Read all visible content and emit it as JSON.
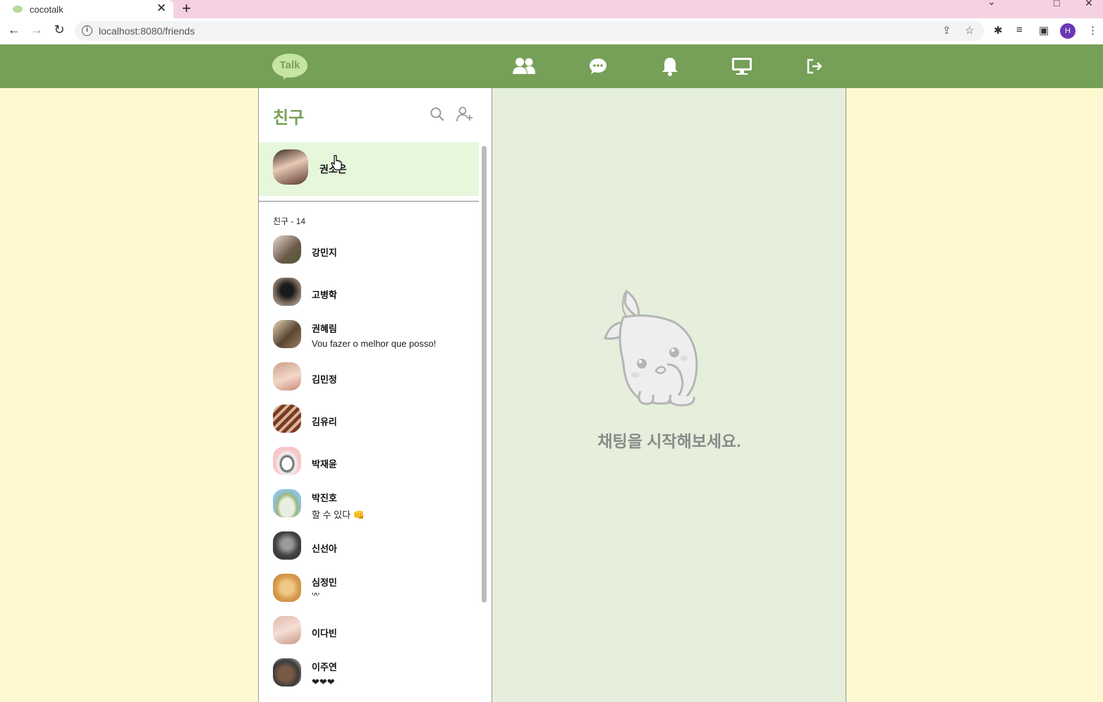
{
  "browser": {
    "tab_title": "cocotalk",
    "tab_close": "✕",
    "new_tab": "+",
    "url": "localhost:8080/friends",
    "profile_initial": "H"
  },
  "app": {
    "logo_text": "Talk",
    "colors": {
      "header": "#76a057",
      "page_bg": "#fef9d0",
      "chat_bg": "#e5efdc",
      "selected_bg": "#e6f7db"
    },
    "nav": [
      "friends-icon",
      "chat-icon",
      "bell-icon",
      "monitor-icon",
      "logout-icon"
    ]
  },
  "friends_panel": {
    "title": "친구",
    "my_profile": {
      "name": "권소은"
    },
    "section_label": "친구 - 14",
    "friends": [
      {
        "name": "강민지",
        "status": ""
      },
      {
        "name": "고병학",
        "status": ""
      },
      {
        "name": "권혜림",
        "status": "Vou fazer o melhor que posso!"
      },
      {
        "name": "김민정",
        "status": ""
      },
      {
        "name": "김유리",
        "status": ""
      },
      {
        "name": "박재윤",
        "status": ""
      },
      {
        "name": "박진호",
        "status": "할 수 있다 👊"
      },
      {
        "name": "신선아",
        "status": ""
      },
      {
        "name": "심정민",
        "status": "'^'"
      },
      {
        "name": "이다빈",
        "status": ""
      },
      {
        "name": "이주연",
        "status": "❤❤❤"
      }
    ]
  },
  "chat": {
    "empty_message": "채팅을 시작해보세요."
  }
}
